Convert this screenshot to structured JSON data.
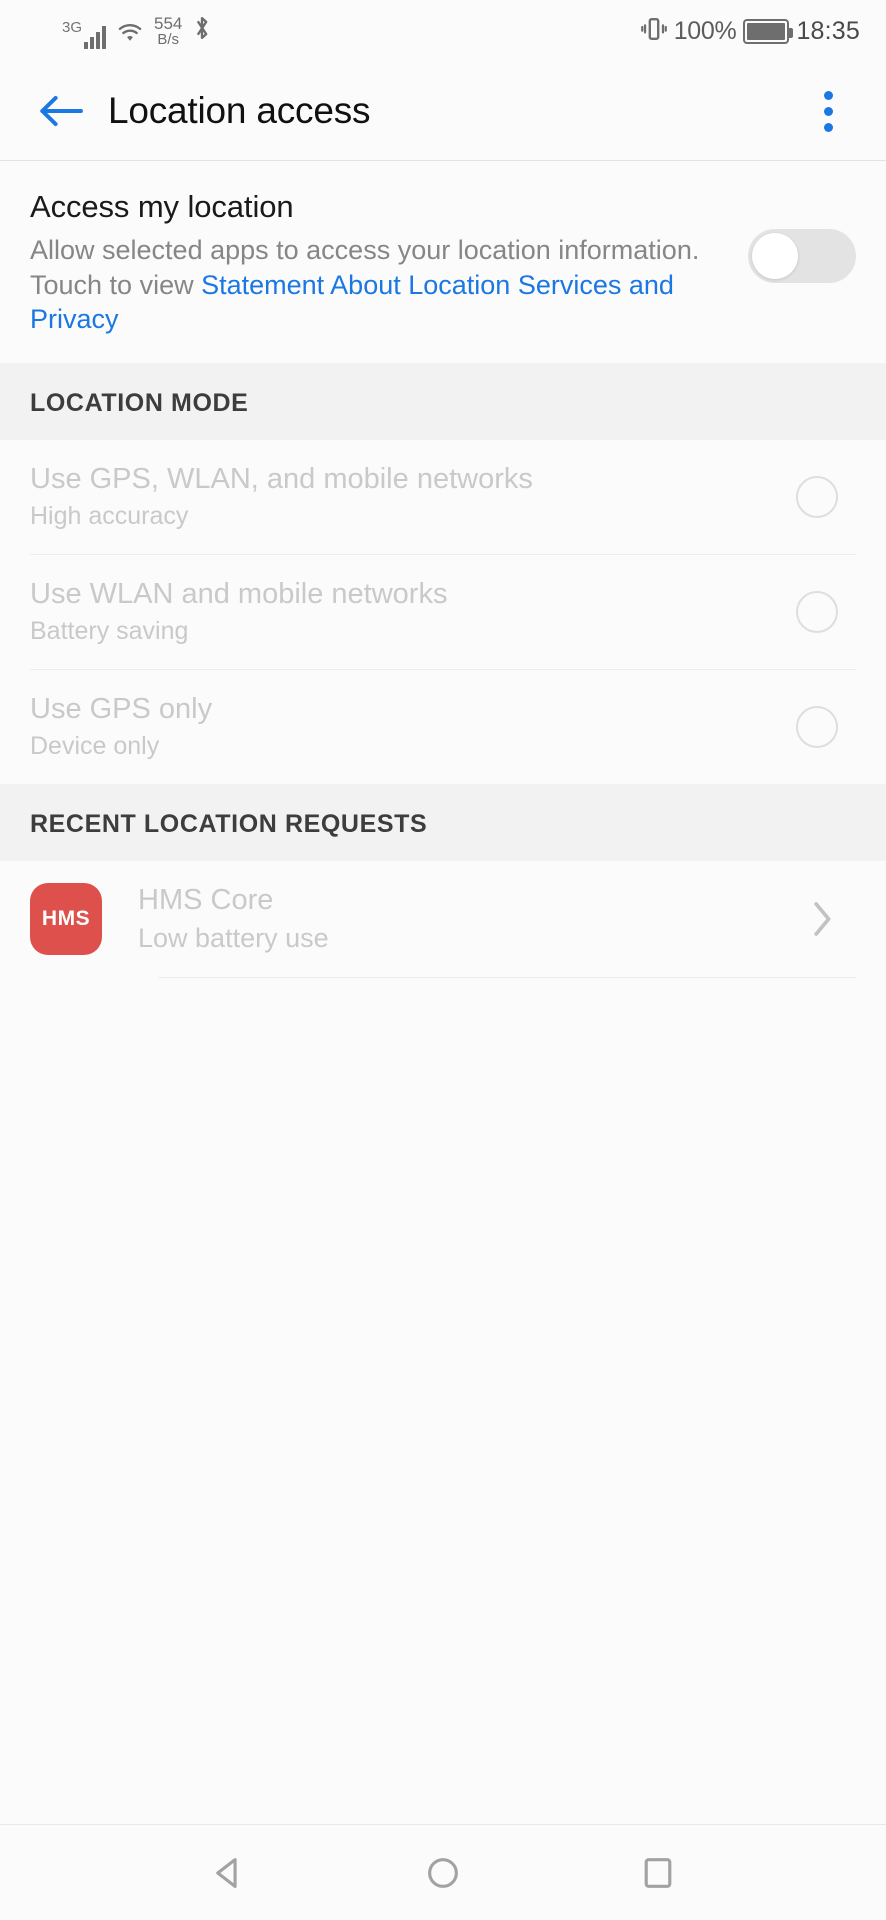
{
  "statusbar": {
    "network_type": "3G",
    "data_rate_value": "554",
    "data_rate_unit": "B/s",
    "battery_percent": "100%",
    "time": "18:35",
    "icons": [
      "signal-bars-icon",
      "wifi-icon",
      "bluetooth-icon",
      "vibrate-icon",
      "battery-icon"
    ]
  },
  "appbar": {
    "title": "Location access",
    "back_icon": "back-arrow-icon",
    "overflow_icon": "overflow-menu-icon",
    "accent_color": "#1b78e2"
  },
  "master": {
    "title": "Access my location",
    "desc_part1": "Allow selected apps to access your location information. Touch to view ",
    "desc_link": "Statement About Location Services and Privacy",
    "switch_state": "off",
    "switch_label": "Access my location"
  },
  "location_mode": {
    "header": "LOCATION MODE",
    "options": [
      {
        "title": "Use GPS, WLAN, and mobile networks",
        "subtitle": "High accuracy",
        "selected": false,
        "enabled": false
      },
      {
        "title": "Use WLAN and mobile networks",
        "subtitle": "Battery saving",
        "selected": false,
        "enabled": false
      },
      {
        "title": "Use GPS only",
        "subtitle": "Device only",
        "selected": false,
        "enabled": false
      }
    ]
  },
  "recent_requests": {
    "header": "RECENT LOCATION REQUESTS",
    "apps": [
      {
        "name": "HMS Core",
        "subtitle": "Low battery use",
        "icon_text": "HMS",
        "icon_color": "#dd504c"
      }
    ]
  },
  "navbar": {
    "back_label": "Back",
    "home_label": "Home",
    "recents_label": "Recents"
  }
}
